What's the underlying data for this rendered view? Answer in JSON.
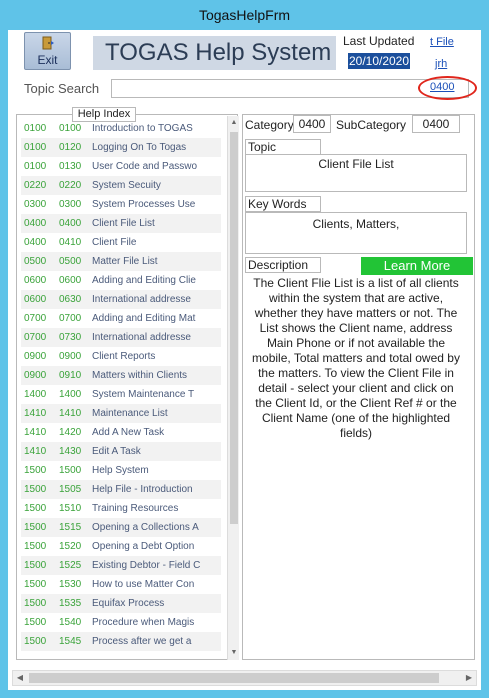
{
  "window": {
    "title": "TogasHelpFrm"
  },
  "toolbar": {
    "exit_label": "Exit"
  },
  "header": {
    "app_title": "TOGAS Help System",
    "last_updated_label": "Last Updated",
    "last_updated_value": "20/10/2020",
    "link_top": "t File",
    "link_user": "jrh"
  },
  "search": {
    "label": "Topic Search",
    "value": "",
    "code_link": "0400"
  },
  "index": {
    "header": "Help Index",
    "rows": [
      {
        "cat": "0100",
        "sub": "0100",
        "title": "Introduction to TOGAS"
      },
      {
        "cat": "0100",
        "sub": "0120",
        "title": "Logging On To Togas"
      },
      {
        "cat": "0100",
        "sub": "0130",
        "title": "User Code and Passwo"
      },
      {
        "cat": "0220",
        "sub": "0220",
        "title": "System Secuity"
      },
      {
        "cat": "0300",
        "sub": "0300",
        "title": "System Processes Use"
      },
      {
        "cat": "0400",
        "sub": "0400",
        "title": "Client File List"
      },
      {
        "cat": "0400",
        "sub": "0410",
        "title": "Client File"
      },
      {
        "cat": "0500",
        "sub": "0500",
        "title": "Matter File List"
      },
      {
        "cat": "0600",
        "sub": "0600",
        "title": "Adding and Editing Clie"
      },
      {
        "cat": "0600",
        "sub": "0630",
        "title": "International addresse"
      },
      {
        "cat": "0700",
        "sub": "0700",
        "title": "Adding and Editing Mat"
      },
      {
        "cat": "0700",
        "sub": "0730",
        "title": "International addresse"
      },
      {
        "cat": "0900",
        "sub": "0900",
        "title": "Client Reports"
      },
      {
        "cat": "0900",
        "sub": "0910",
        "title": "Matters within Clients"
      },
      {
        "cat": "1400",
        "sub": "1400",
        "title": "System Maintenance T"
      },
      {
        "cat": "1410",
        "sub": "1410",
        "title": "Maintenance List"
      },
      {
        "cat": "1410",
        "sub": "1420",
        "title": "Add A New Task"
      },
      {
        "cat": "1410",
        "sub": "1430",
        "title": "Edit A Task"
      },
      {
        "cat": "1500",
        "sub": "1500",
        "title": "Help System"
      },
      {
        "cat": "1500",
        "sub": "1505",
        "title": "Help File - Introduction"
      },
      {
        "cat": "1500",
        "sub": "1510",
        "title": "Training Resources"
      },
      {
        "cat": "1500",
        "sub": "1515",
        "title": "Opening a Collections A"
      },
      {
        "cat": "1500",
        "sub": "1520",
        "title": "Opening a Debt Option"
      },
      {
        "cat": "1500",
        "sub": "1525",
        "title": "Existing Debtor - Field C"
      },
      {
        "cat": "1500",
        "sub": "1530",
        "title": "How to use Matter Con"
      },
      {
        "cat": "1500",
        "sub": "1535",
        "title": "Equifax Process"
      },
      {
        "cat": "1500",
        "sub": "1540",
        "title": "Procedure when Magis"
      },
      {
        "cat": "1500",
        "sub": "1545",
        "title": "Process after we get a"
      }
    ]
  },
  "detail": {
    "category_label": "Category",
    "category_value": "0400",
    "subcategory_label": "SubCategory",
    "subcategory_value": "0400",
    "topic_label": "Topic",
    "topic_value": "Client File List",
    "keywords_label": "Key Words",
    "keywords_value": "Clients, Matters,",
    "description_label": "Description",
    "learn_more_label": "Learn More",
    "description_value": "The Client Flie List is a list of all clients within the system that are active, whether they have matters or not. The List shows the Client name, address Main Phone or if not available the mobile, Total matters and total owed by the matters. To view the Client File in detail - select your client and click on the Client Id, or the Client Ref # or the Client Name (one of the highlighted fields)"
  },
  "colors": {
    "window_bg": "#5fc3e8",
    "code_green": "#3aa33a",
    "learn_more_bg": "#22c436",
    "highlight": "#1b4f9c",
    "annotation": "#e0261c"
  },
  "icons": [
    "door-exit-icon",
    "scroll-up-icon",
    "scroll-down-icon",
    "scroll-left-icon",
    "scroll-right-icon"
  ]
}
